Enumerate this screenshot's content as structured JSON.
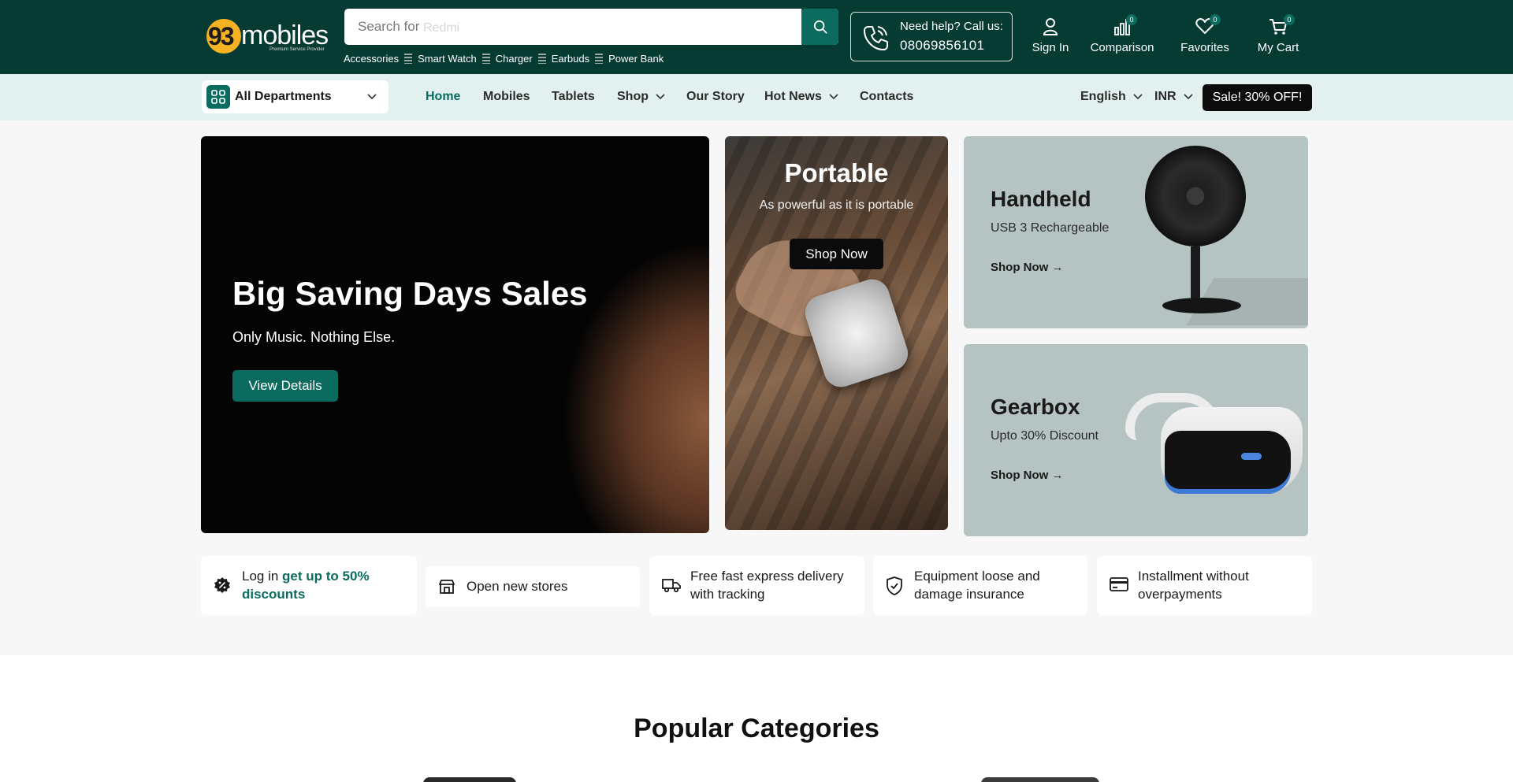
{
  "header": {
    "logo_number": "93",
    "logo_word": "mobiles",
    "logo_tagline": "Premium Service Provider",
    "search": {
      "placeholder": "Search for",
      "ghost_text": "Redmi"
    },
    "quick_links": [
      "Accessories",
      "Smart Watch",
      "Charger",
      "Earbuds",
      "Power Bank"
    ],
    "help": {
      "title": "Need help? Call us:",
      "phone": "08069856101"
    },
    "actions": {
      "sign_in": "Sign In",
      "comparison": {
        "label": "Comparison",
        "count": "0"
      },
      "favorites": {
        "label": "Favorites",
        "count": "0"
      },
      "cart": {
        "label": "My Cart",
        "count": "0"
      }
    }
  },
  "nav": {
    "departments": "All Departments",
    "items": [
      "Home",
      "Mobiles",
      "Tablets",
      "Shop",
      "Our Story",
      "Hot News",
      "Contacts"
    ],
    "active_item": "Home",
    "language": "English",
    "currency": "INR",
    "sale": "Sale! 30% OFF!"
  },
  "hero": {
    "title": "Big Saving Days Sales",
    "subtitle": "Only Music. Nothing Else.",
    "button": "View Details"
  },
  "portable": {
    "title": "Portable",
    "subtitle": "As powerful as it is portable",
    "button": "Shop Now"
  },
  "promos": [
    {
      "title": "Handheld",
      "subtitle": "USB 3 Rechargeable",
      "link": "Shop Now →"
    },
    {
      "title": "Gearbox",
      "subtitle": "Upto 30% Discount",
      "link": "Shop Now →"
    }
  ],
  "features": [
    {
      "prefix": "Log in ",
      "highlight": "get up to 50% discounts"
    },
    {
      "text": "Open new stores"
    },
    {
      "text": "Free fast express delivery with tracking"
    },
    {
      "text": "Equipment loose and damage insurance"
    },
    {
      "text": "Installment without overpayments"
    }
  ],
  "popular": {
    "title": "Popular Categories"
  },
  "colors": {
    "header_bg": "#063b34",
    "accent": "#0b6b5e",
    "nav_bg": "#e2f1ef",
    "logo_yellow": "#f5b324"
  }
}
